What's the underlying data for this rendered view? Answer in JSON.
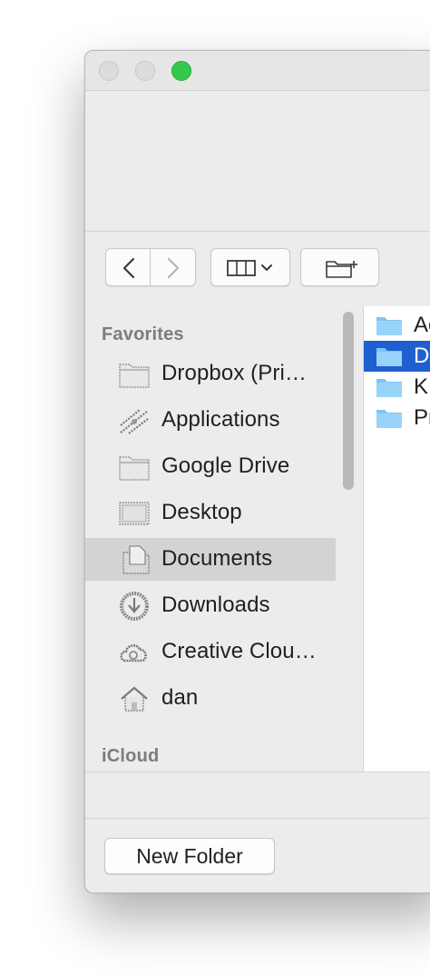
{
  "window": {
    "traffic_lights": {
      "close_color": "#dcdcdc",
      "minimize_color": "#dcdcdc",
      "zoom_color": "#34c84a"
    }
  },
  "toolbar": {
    "back_icon": "chevron-left-icon",
    "forward_icon": "chevron-right-icon",
    "view_icon": "columns-view-icon",
    "new_folder_icon": "new-folder-icon"
  },
  "sidebar": {
    "favorites_header": "Favorites",
    "items": [
      {
        "label": "Dropbox (Pri…",
        "icon": "folder-icon"
      },
      {
        "label": "Applications",
        "icon": "applications-icon"
      },
      {
        "label": "Google Drive",
        "icon": "folder-icon"
      },
      {
        "label": "Desktop",
        "icon": "desktop-icon"
      },
      {
        "label": "Documents",
        "icon": "documents-icon",
        "selected": true
      },
      {
        "label": "Downloads",
        "icon": "downloads-icon"
      },
      {
        "label": "Creative Clou…",
        "icon": "creative-cloud-icon"
      },
      {
        "label": "dan",
        "icon": "home-icon"
      }
    ],
    "icloud_header": "iCloud"
  },
  "files": [
    {
      "label": "Ac",
      "icon": "folder-icon"
    },
    {
      "label": "D",
      "icon": "folder-icon",
      "selected": true
    },
    {
      "label": "K",
      "icon": "folder-icon"
    },
    {
      "label": "Pr",
      "icon": "folder-icon"
    }
  ],
  "bottom": {
    "new_folder_label": "New Folder"
  },
  "colors": {
    "selection_blue": "#1f5fd0",
    "folder_blue": "#7cc4f5"
  }
}
